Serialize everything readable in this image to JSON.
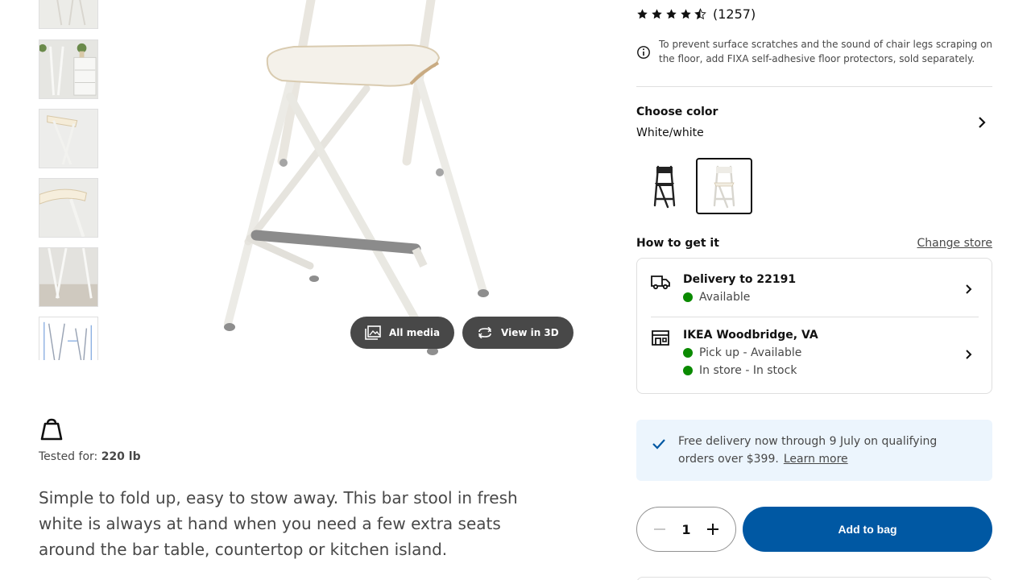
{
  "gallery": {
    "thumbnails": [
      "bar stool thumbnail 1",
      "bar stool thumbnail 2",
      "bar stool thumbnail 3",
      "bar stool thumbnail 4",
      "bar stool thumbnail 5",
      "bar stool thumbnail 6"
    ],
    "all_media_label": "All media",
    "view_3d_label": "View in 3D"
  },
  "product": {
    "tested_label": "Tested for: ",
    "tested_value": "220 lb",
    "description": "Simple to fold up, easy to stow away. This bar stool in fresh white is always at hand when you need a few extra seats around the bar table, countertop or kitchen island."
  },
  "rating": {
    "stars": 4.5,
    "review_count": "(1257)"
  },
  "notice": {
    "text": "To prevent surface scratches and the sound of chair legs scraping on the floor, add FIXA self-adhesive floor protectors, sold separately."
  },
  "color": {
    "title": "Choose color",
    "selected": "White/white",
    "swatches": [
      "black",
      "white"
    ]
  },
  "how_to_get": {
    "title": "How to get it",
    "change_store": "Change store",
    "delivery": {
      "title": "Delivery to 22191",
      "status": "Available"
    },
    "store": {
      "title": "IKEA Woodbridge, VA",
      "pickup": "Pick up - Available",
      "instore": "In store - In stock"
    }
  },
  "promo": {
    "text": "Free delivery now through 9 July on qualifying orders over $399.",
    "link": "Learn more"
  },
  "purchase": {
    "quantity": "1",
    "add_label": "Add to bag"
  },
  "colors": {
    "accent": "#0058a3",
    "available": "#0a8a00",
    "promo_bg": "#ecf5fd",
    "media_button": "#484848"
  }
}
